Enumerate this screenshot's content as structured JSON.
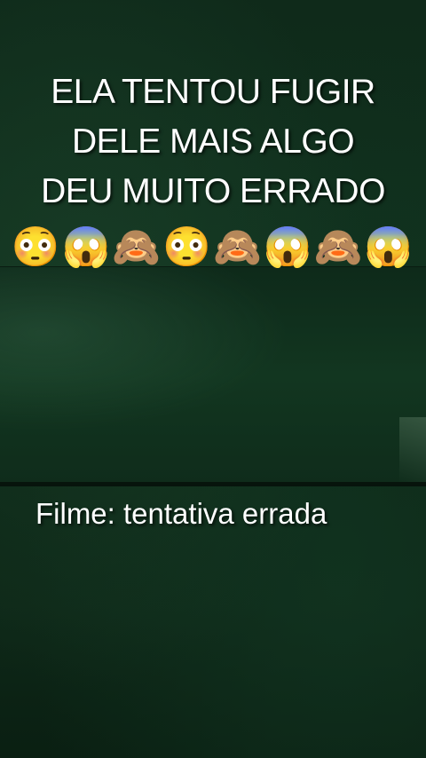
{
  "caption": {
    "line1": "ELA TENTOU FUGIR",
    "line2": "DELE MAIS ALGO",
    "line3": "DEU MUITO ERRADO"
  },
  "emoji_row": "😳😱🙈😳🙈😱🙈😱",
  "subtitle": "Filme: tentativa errada"
}
